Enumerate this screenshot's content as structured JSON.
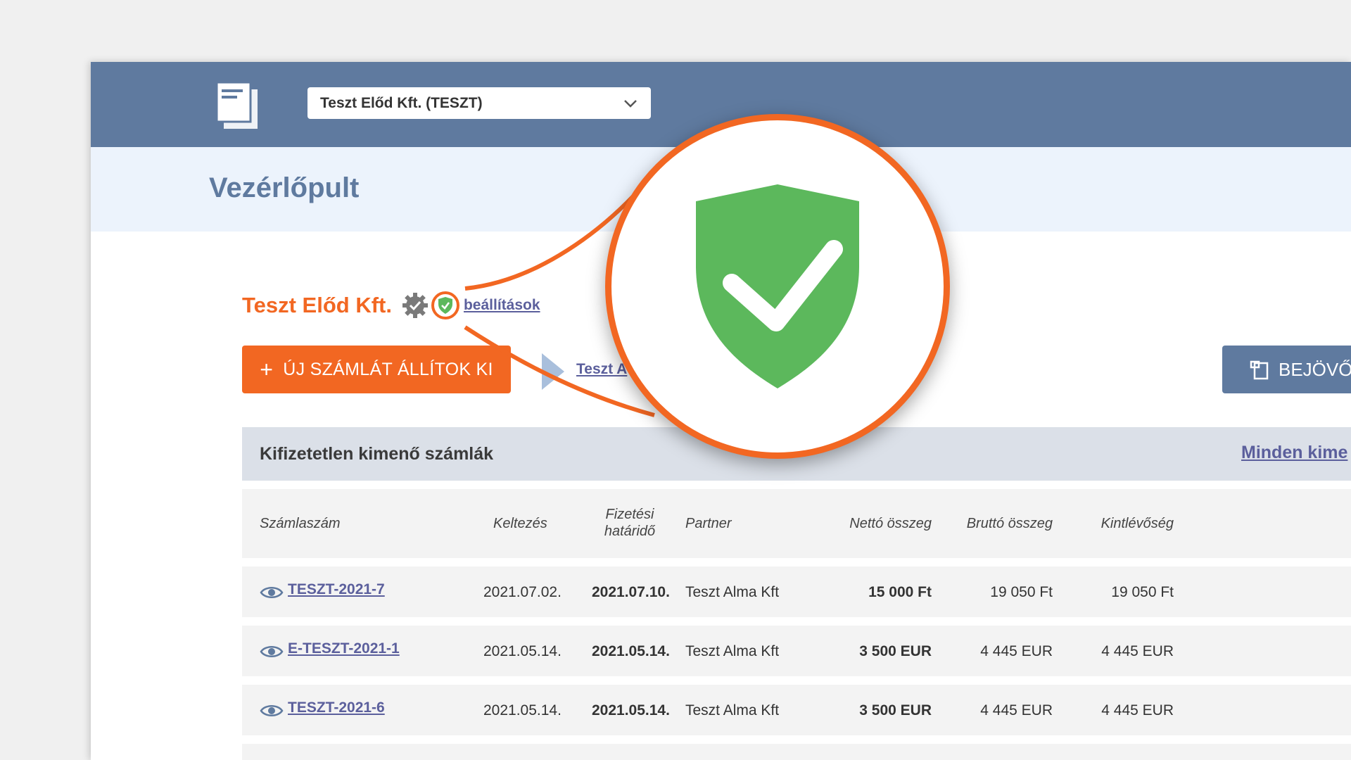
{
  "header": {
    "logo_icon": "documents-icon",
    "company_select": {
      "value": "Teszt Előd Kft. (TESZT)",
      "icon": "chevron-down-icon"
    }
  },
  "page": {
    "title": "Vezérlőpult"
  },
  "company": {
    "name": "Teszt Előd Kft.",
    "verified_icon": "gear-badge-icon",
    "security_icon": "shield-check-icon",
    "settings_link": "beállítások"
  },
  "actions": {
    "new_invoice": "ÚJ SZÁMLÁT ÁLLÍTOK KI",
    "new_invoice_icon": "plus-icon",
    "partner_link": "Teszt A",
    "incoming": "BEJÖVŐ",
    "incoming_icon": "incoming-document-icon"
  },
  "unpaid_section": {
    "title": "Kifizetetlen kimenő számlák",
    "all_link": "Minden kime"
  },
  "table": {
    "headers": {
      "number": "Számlaszám",
      "date": "Keltezés",
      "due_line1": "Fizetési",
      "due_line2": "határidő",
      "partner": "Partner",
      "net": "Nettó összeg",
      "gross": "Bruttó összeg",
      "outstanding": "Kintlévőség"
    },
    "rows": [
      {
        "number": "TESZT-2021-7",
        "date": "2021.07.02.",
        "due": "2021.07.10.",
        "partner": "Teszt Alma Kft",
        "net": "15 000 Ft",
        "gross": "19 050 Ft",
        "outstanding": "19 050 Ft"
      },
      {
        "number": "E-TESZT-2021-1",
        "date": "2021.05.14.",
        "due": "2021.05.14.",
        "partner": "Teszt Alma Kft",
        "net": "3 500 EUR",
        "gross": "4 445 EUR",
        "outstanding": "4 445 EUR"
      },
      {
        "number": "TESZT-2021-6",
        "date": "2021.05.14.",
        "due": "2021.05.14.",
        "partner": "Teszt Alma Kft",
        "net": "3 500 EUR",
        "gross": "4 445 EUR",
        "outstanding": "4 445 EUR"
      }
    ]
  },
  "colors": {
    "topbar": "#5f7a9f",
    "accent": "#f26722",
    "shield_green": "#5cb85c",
    "link": "#5b5f9c"
  }
}
